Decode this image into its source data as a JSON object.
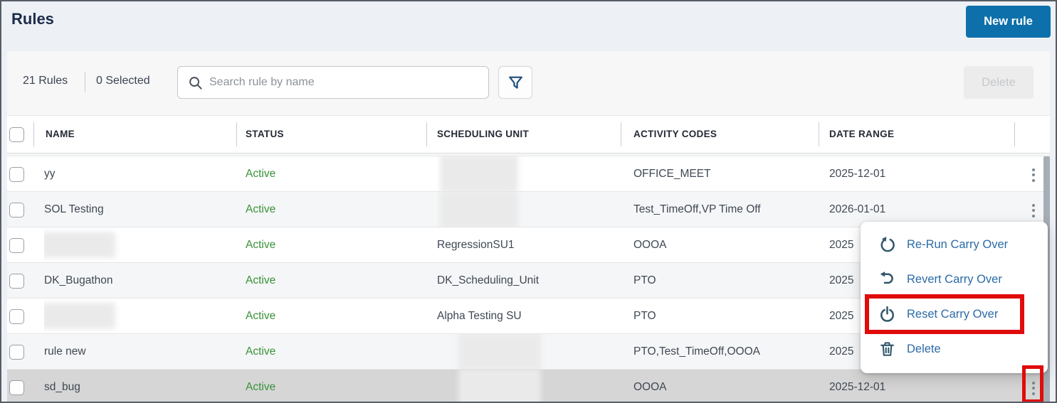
{
  "header": {
    "title": "Rules",
    "new_rule_button": "New rule"
  },
  "toolbar": {
    "rules_count": "21 Rules",
    "selected_count": "0 Selected",
    "search_placeholder": "Search rule by name",
    "delete_button": "Delete"
  },
  "table": {
    "columns": [
      "NAME",
      "STATUS",
      "SCHEDULING UNIT",
      "ACTIVITY CODES",
      "DATE RANGE"
    ],
    "rows": [
      {
        "name": "yy",
        "name_blurred": false,
        "status": "Active",
        "scheduling_unit": "",
        "scheduling_unit_blurred": true,
        "activity_codes": "OFFICE_MEET",
        "date_range": "2025-12-01",
        "selected": false
      },
      {
        "name": "SOL Testing",
        "name_blurred": false,
        "status": "Active",
        "scheduling_unit": "",
        "scheduling_unit_blurred": true,
        "activity_codes": "Test_TimeOff,VP Time Off",
        "date_range": "2026-01-01",
        "selected": false
      },
      {
        "name": "",
        "name_blurred": true,
        "status": "Active",
        "scheduling_unit": "RegressionSU1",
        "scheduling_unit_blurred": false,
        "activity_codes": "OOOA",
        "date_range": "2025",
        "selected": false
      },
      {
        "name": "DK_Bugathon",
        "name_blurred": false,
        "status": "Active",
        "scheduling_unit": "DK_Scheduling_Unit",
        "scheduling_unit_blurred": false,
        "activity_codes": "PTO",
        "date_range": "2025",
        "selected": false
      },
      {
        "name": "",
        "name_blurred": true,
        "status": "Active",
        "scheduling_unit": "Alpha Testing SU",
        "scheduling_unit_blurred": false,
        "activity_codes": "PTO",
        "date_range": "2025",
        "selected": false
      },
      {
        "name": "rule new",
        "name_blurred": false,
        "status": "Active",
        "scheduling_unit": "",
        "scheduling_unit_blurred": true,
        "activity_codes": "PTO,Test_TimeOff,OOOA",
        "date_range": "2025",
        "selected": false
      },
      {
        "name": "sd_bug",
        "name_blurred": false,
        "status": "Active",
        "scheduling_unit": "",
        "scheduling_unit_blurred": true,
        "activity_codes": "OOOA",
        "date_range": "2025-12-01",
        "selected": true
      }
    ]
  },
  "context_menu": {
    "items": [
      {
        "label": "Re-Run Carry Over",
        "icon": "rerun-carry-over-icon",
        "highlighted": false
      },
      {
        "label": "Revert Carry Over",
        "icon": "revert-carry-over-icon",
        "highlighted": false
      },
      {
        "label": "Reset Carry Over",
        "icon": "reset-carry-over-icon",
        "highlighted": true
      },
      {
        "label": "Delete",
        "icon": "delete-icon",
        "highlighted": false
      }
    ]
  },
  "colors": {
    "primary_blue": "#0d70ab",
    "active_green": "#389238",
    "menu_link_blue": "#2b6ba8",
    "menu_icon_slate": "#30566b",
    "annotation_red": "#e00b0b",
    "selected_row_gray": "#d6d6d6"
  }
}
